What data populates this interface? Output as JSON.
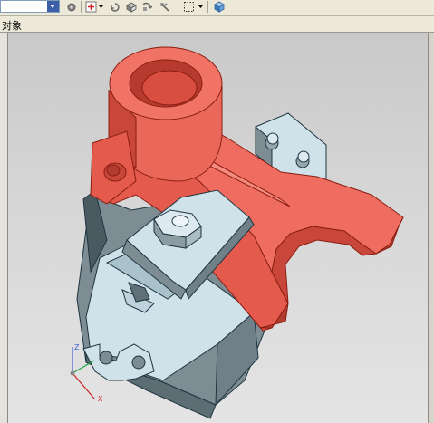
{
  "toolbar": {
    "selection_filter": "",
    "icons": [
      "dropdown-arrow-icon",
      "settings-icon",
      "snap-point-icon",
      "undo-icon",
      "shaded-view-icon",
      "rotate-icon",
      "pan-icon",
      "zoom-box-icon",
      "cube-icon"
    ]
  },
  "tab": {
    "label": "对象"
  },
  "viewport": {
    "axis_labels": {
      "x": "X",
      "z": "Z"
    },
    "colors": {
      "highlight": "#ee6b5e",
      "part": "#cfe2ea",
      "edge": "#1f3540",
      "background": "#d4d4d4"
    }
  }
}
